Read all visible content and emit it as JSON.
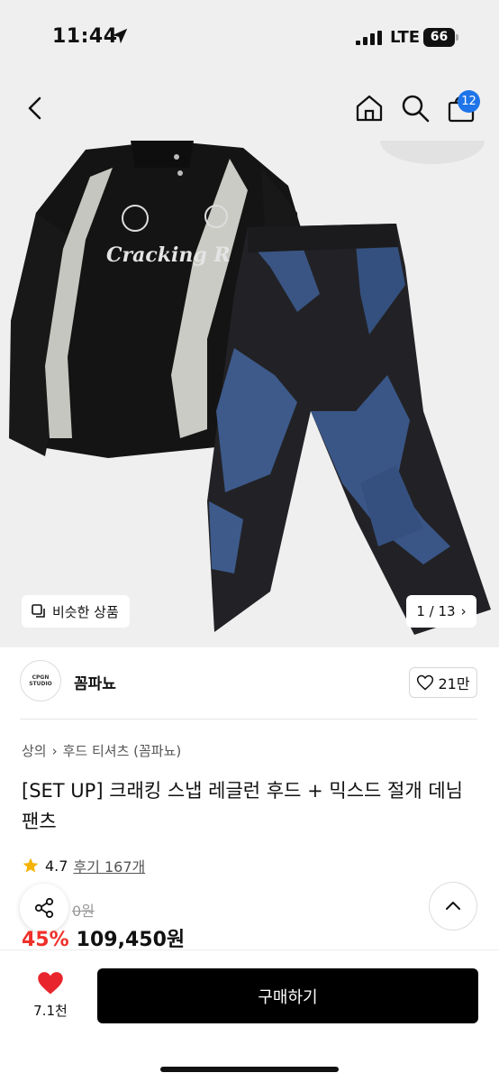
{
  "status_bar": {
    "time": "11:44",
    "network": "LTE",
    "battery": "66"
  },
  "nav": {
    "cart_count": "12"
  },
  "gallery": {
    "similar_label": "비슷한 상품",
    "page_indicator": "1 / 13",
    "sweatshirt_print": "Cracking R"
  },
  "brand": {
    "name": "꼼파뇨",
    "logo_text": "CPGN STUDIO",
    "likes": "21만"
  },
  "breadcrumb": [
    "상의",
    "후드 티셔츠 (꼼파뇨)"
  ],
  "product": {
    "title": "[SET UP] 크래킹 스냅 레글런 후드 + 믹스드 절개 데님 팬츠",
    "rating": "4.7",
    "reviews": "후기 167개",
    "original_price": "0원",
    "discount": "45%",
    "price": "109,450원"
  },
  "bottom": {
    "wish_count": "7.1천",
    "buy_label": "구매하기"
  },
  "colors": {
    "accent_blue": "#1e74e8",
    "discount_red": "#f0302a",
    "heart_red": "#e8252c",
    "star": "#f5b300"
  }
}
